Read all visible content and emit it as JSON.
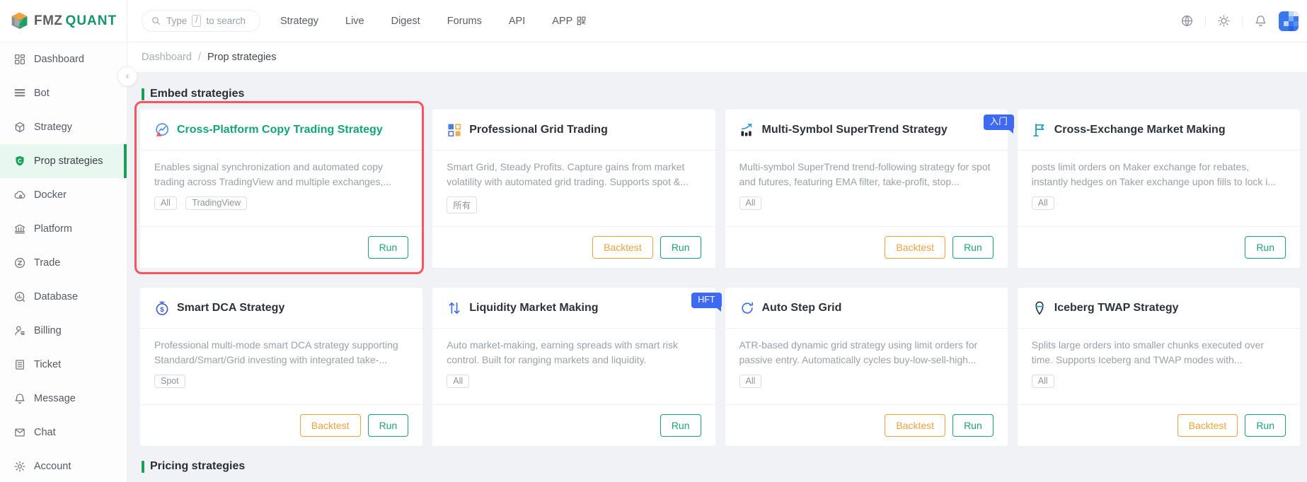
{
  "brand": {
    "fmz": "FMZ",
    "quant": "QUANT"
  },
  "header": {
    "search": {
      "prefix": "Type",
      "key": "/",
      "suffix": "to search"
    },
    "nav": {
      "strategy": "Strategy",
      "live": "Live",
      "digest": "Digest",
      "forums": "Forums",
      "api": "API",
      "app": "APP"
    }
  },
  "sidebar": {
    "items": [
      {
        "label": "Dashboard"
      },
      {
        "label": "Bot"
      },
      {
        "label": "Strategy"
      },
      {
        "label": "Prop strategies"
      },
      {
        "label": "Docker"
      },
      {
        "label": "Platform"
      },
      {
        "label": "Trade"
      },
      {
        "label": "Database"
      },
      {
        "label": "Billing"
      },
      {
        "label": "Ticket"
      },
      {
        "label": "Message"
      },
      {
        "label": "Chat"
      },
      {
        "label": "Account"
      }
    ]
  },
  "breadcrumb": {
    "root": "Dashboard",
    "separator": "/",
    "current": "Prop strategies"
  },
  "sections": {
    "embed_title": "Embed strategies",
    "pricing_title": "Pricing strategies"
  },
  "buttons": {
    "run": "Run",
    "backtest": "Backtest"
  },
  "ui": {
    "collapse_glyph": "‹"
  },
  "colors": {
    "accent_green": "#18a058",
    "run_green": "#1ba37a",
    "backtest_orange": "#f0a23e",
    "badge_blue": "#3e6af2",
    "highlight_red": "#f6555f"
  },
  "cards": [
    {
      "title": "Cross-Platform Copy Trading Strategy",
      "description": "Enables signal synchronization and automated copy trading across TradingView and multiple exchanges,...",
      "tags": [
        "All",
        "TradingView"
      ],
      "badge": ""
    },
    {
      "title": "Professional Grid Trading",
      "description": "Smart Grid, Steady Profits. Capture gains from market volatility with automated grid trading. Supports spot &...",
      "tags": [
        "所有"
      ],
      "badge": ""
    },
    {
      "title": "Multi-Symbol SuperTrend Strategy",
      "description": "Multi-symbol SuperTrend trend-following strategy for spot and futures, featuring EMA filter, take-profit, stop...",
      "tags": [
        "All"
      ],
      "badge": "入门"
    },
    {
      "title": "Cross-Exchange Market Making",
      "description": "posts limit orders on Maker exchange for rebates, instantly hedges on Taker exchange upon fills to lock i...",
      "tags": [
        "All"
      ],
      "badge": ""
    },
    {
      "title": "Smart DCA Strategy",
      "description": "Professional multi-mode smart DCA strategy supporting Standard/Smart/Grid investing with integrated take-...",
      "tags": [
        "Spot"
      ],
      "badge": ""
    },
    {
      "title": "Liquidity Market Making",
      "description": "Auto market-making, earning spreads with smart risk control. Built for ranging markets and liquidity.",
      "tags": [
        "All"
      ],
      "badge": "HFT"
    },
    {
      "title": "Auto Step Grid",
      "description": "ATR-based dynamic grid strategy using limit orders for passive entry. Automatically cycles buy-low-sell-high...",
      "tags": [
        "All"
      ],
      "badge": ""
    },
    {
      "title": "Iceberg TWAP Strategy",
      "description": "Splits large orders into smaller chunks executed over time. Supports Iceberg and TWAP modes with...",
      "tags": [
        "All"
      ],
      "badge": ""
    }
  ]
}
